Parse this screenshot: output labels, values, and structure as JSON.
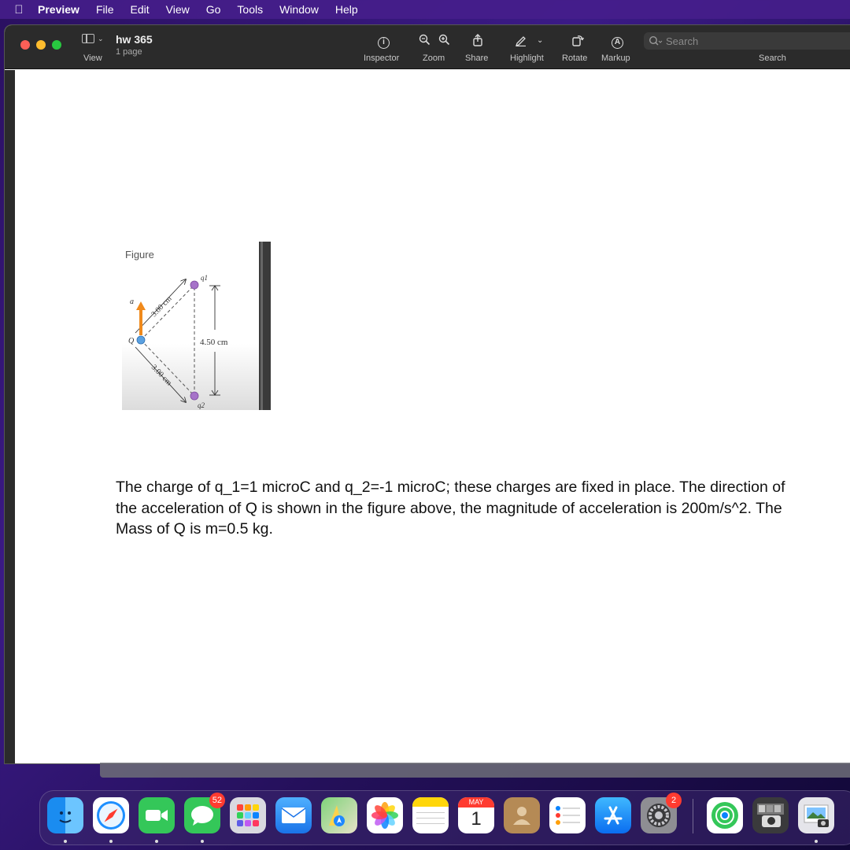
{
  "menubar": {
    "app": "Preview",
    "items": [
      "File",
      "Edit",
      "View",
      "Go",
      "Tools",
      "Window",
      "Help"
    ]
  },
  "toolbar": {
    "view_label": "View",
    "doc_title": "hw 365",
    "doc_pages": "1 page",
    "inspector": "Inspector",
    "zoom": "Zoom",
    "share": "Share",
    "highlight": "Highlight",
    "rotate": "Rotate",
    "markup": "Markup",
    "search_placeholder": "Search",
    "search_label": "Search"
  },
  "figure": {
    "title": "Figure",
    "q1_label": "q1",
    "q2_label": "q2",
    "Q_label": "Q",
    "a_label": "a",
    "dist_top": "3.00 cm",
    "dist_bottom": "3.00 cm",
    "vertical": "4.50 cm"
  },
  "problem": {
    "text": "The charge of q_1=1 microC and q_2=-1 microC; these charges are fixed in place. The direction of the acceleration of Q is shown in the figure above, the magnitude of acceleration is 200m/s^2. The Mass of Q is m=0.5 kg."
  },
  "dock": {
    "messages_badge": "52",
    "calendar_month": "MAY",
    "calendar_day": "1",
    "settings_badge": "2",
    "apps": [
      "Finder",
      "Safari",
      "FaceTime",
      "Messages",
      "Launchpad",
      "Mail",
      "Maps",
      "Photos",
      "Notes",
      "Calendar",
      "Contacts",
      "Reminders",
      "App Store",
      "System Preferences",
      "Find My",
      "Image Capture",
      "Preview"
    ]
  },
  "colors": {
    "accent_orange": "#f08a1c",
    "charge_purple": "#a673c9",
    "charge_blue": "#5aa0e0"
  }
}
